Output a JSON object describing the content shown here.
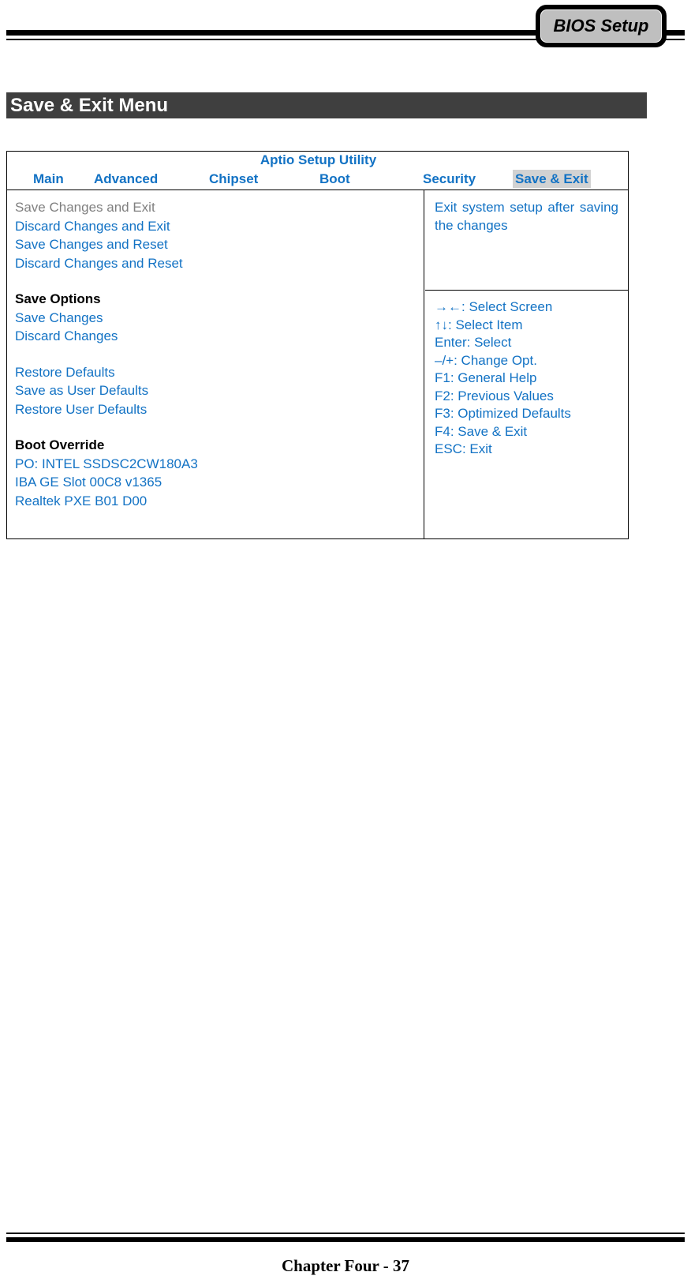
{
  "header": {
    "badge_label": "BIOS Setup"
  },
  "section": {
    "title": "Save & Exit Menu"
  },
  "bios": {
    "utility_title": "Aptio Setup Utility",
    "tabs": [
      {
        "label": "Main",
        "active": false
      },
      {
        "label": "Advanced",
        "active": false
      },
      {
        "label": "Chipset",
        "active": false
      },
      {
        "label": "Boot",
        "active": false
      },
      {
        "label": "Security",
        "active": false
      },
      {
        "label": "Save & Exit",
        "active": true
      }
    ],
    "options": [
      {
        "label": "Save Changes and Exit",
        "style": "muted"
      },
      {
        "label": "Discard Changes and Exit",
        "style": "link"
      },
      {
        "label": "Save Changes and Reset",
        "style": "link"
      },
      {
        "label": "Discard Changes and Reset",
        "style": "link"
      },
      {
        "label": "Save Options",
        "style": "heading"
      },
      {
        "label": "Save Changes",
        "style": "link"
      },
      {
        "label": "Discard Changes",
        "style": "link"
      },
      {
        "label": "Restore Defaults",
        "style": "link"
      },
      {
        "label": "Save as User Defaults",
        "style": "link"
      },
      {
        "label": "Restore User Defaults",
        "style": "link"
      },
      {
        "label": "Boot Override",
        "style": "heading"
      },
      {
        "label": "PO: INTEL SSDSC2CW180A3",
        "style": "link"
      },
      {
        "label": "IBA GE Slot 00C8 v1365",
        "style": "link"
      },
      {
        "label": "Realtek PXE B01 D00",
        "style": "link"
      }
    ],
    "help_text": "Exit system setup after saving the changes",
    "legend": [
      "→←: Select Screen",
      "↑↓: Select Item",
      "Enter: Select",
      "–/+: Change Opt.",
      "F1: General Help",
      "F2: Previous Values",
      "F3: Optimized Defaults",
      "F4: Save & Exit",
      "ESC: Exit"
    ]
  },
  "footer": {
    "page_label": "Chapter Four - 37"
  },
  "colors": {
    "link_blue": "#1272c4",
    "muted_gray": "#808080",
    "title_bar": "#3f3f3f",
    "tab_highlight": "#d2d2d2",
    "badge_fill": "#bfbfbf"
  }
}
